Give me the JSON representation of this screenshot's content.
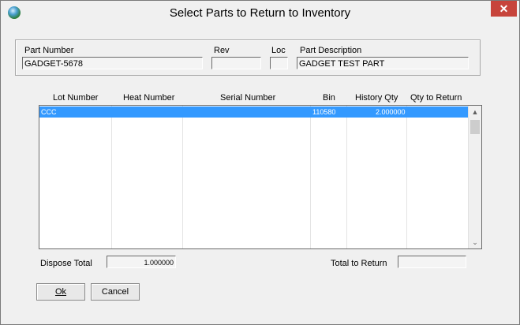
{
  "window": {
    "title": "Select Parts to Return to Inventory",
    "close_glyph": "✕"
  },
  "part": {
    "number_label": "Part Number",
    "number_value": "GADGET-5678",
    "rev_label": "Rev",
    "rev_value": "",
    "loc_label": "Loc",
    "loc_value": "",
    "desc_label": "Part Description",
    "desc_value": "GADGET TEST PART"
  },
  "grid": {
    "columns": [
      "Lot Number",
      "Heat Number",
      "Serial Number",
      "Bin",
      "History Qty",
      "Qty to Return"
    ],
    "rows": [
      {
        "lot": "CCC",
        "heat": "",
        "serial": "",
        "bin": "110580",
        "history_qty": "2.000000",
        "qty_to_return": ""
      }
    ],
    "scroll_down_glyph": "⌄"
  },
  "totals": {
    "dispose_label": "Dispose Total",
    "dispose_value": "1.000000",
    "return_label": "Total to Return",
    "return_value": ""
  },
  "buttons": {
    "ok": "Ok",
    "cancel": "Cancel"
  },
  "colors": {
    "selection": "#3399ff",
    "close": "#c7443b"
  }
}
